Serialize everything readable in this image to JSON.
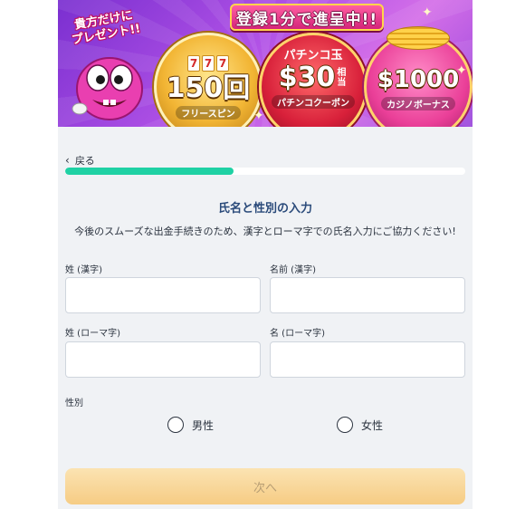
{
  "banner": {
    "ribbon_text": "登録1分で進呈中!!",
    "present_line1": "貴方だけに",
    "present_line2": "プレゼント!!",
    "badges": [
      {
        "slot": [
          "7",
          "7",
          "7"
        ],
        "big": "150回",
        "sub": "フリースピン"
      },
      {
        "top": "パチンコ玉",
        "big": "$30",
        "note": "相当",
        "sub": "パチンコクーポン"
      },
      {
        "big": "$1000",
        "sub": "カジノボーナス"
      }
    ]
  },
  "nav": {
    "back_label": "戻る"
  },
  "progress": {
    "value": 0.42,
    "color": "#1fd1a4"
  },
  "form": {
    "title": "氏名と性別の入力",
    "description": "今後のスムーズな出金手続きのため、漢字とローマ字での氏名入力にご協力ください!",
    "fields": {
      "last_name_kanji": {
        "label": "姓 (漢字)",
        "value": ""
      },
      "first_name_kanji": {
        "label": "名前 (漢字)",
        "value": ""
      },
      "last_name_roman": {
        "label": "姓 (ローマ字)",
        "value": ""
      },
      "first_name_roman": {
        "label": "名 (ローマ字)",
        "value": ""
      }
    },
    "gender": {
      "label": "性別",
      "options": [
        "男性",
        "女性"
      ]
    },
    "next_label": "次へ"
  },
  "colors": {
    "accent": "#1fd1a4",
    "title": "#2a4a7a",
    "button_bg": "#f6cc84",
    "panel_bg": "#f0f2f5"
  }
}
